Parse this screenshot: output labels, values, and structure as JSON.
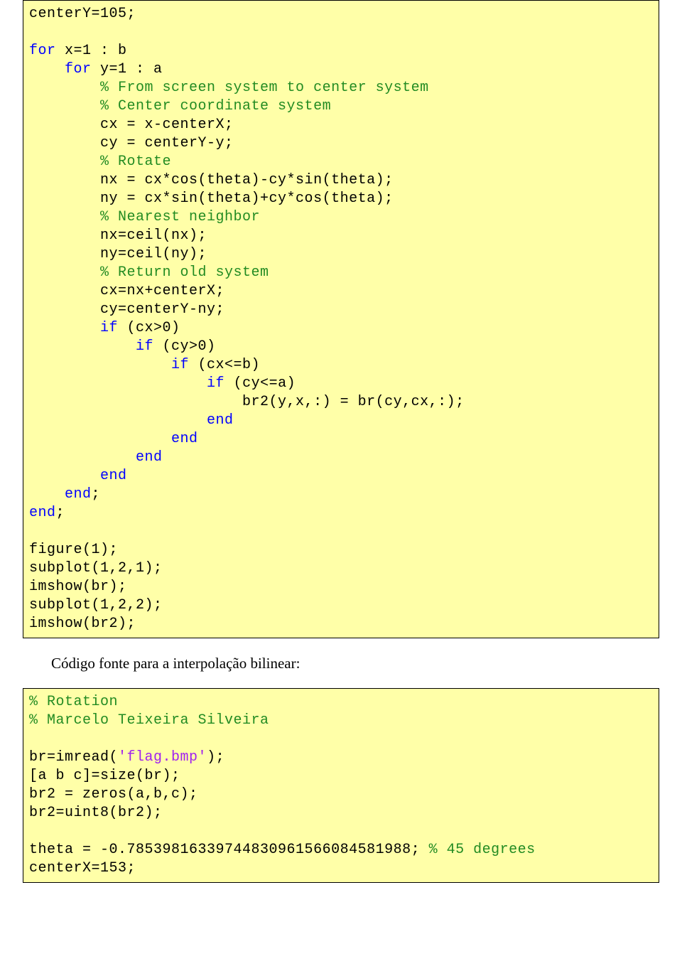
{
  "code1": {
    "l0": "centerY=105;",
    "l1": "",
    "k_for": "for",
    "x_loop": " x=1 : b",
    "y_loop": " y=1 : a",
    "c1": "% From screen system to center system",
    "c2": "% Center coordinate system",
    "l2": "cx = x-centerX;",
    "l3": "cy = centerY-y;",
    "c3": "% Rotate",
    "l4": "nx = cx*cos(theta)-cy*sin(theta);",
    "l5": "ny = cx*sin(theta)+cy*cos(theta);",
    "c4": "% Nearest neighbor",
    "l6": "nx=ceil(nx);",
    "l7": "ny=ceil(ny);",
    "c5": "% Return old system",
    "l8": "cx=nx+centerX;",
    "l9": "cy=centerY-ny;",
    "k_if": "if",
    "if1": " (cx>0)",
    "if2": " (cy>0)",
    "if3": " (cx<=b)",
    "if4": " (cy<=a)",
    "l10": "br2(y,x,:) = br(cy,cx,:);",
    "k_end": "end",
    "l11": "end;",
    "l12": "figure(1);",
    "l13": "subplot(1,2,1);",
    "l14": "imshow(br);",
    "l15": "subplot(1,2,2);",
    "l16": "imshow(br2);"
  },
  "paragraph": "Código fonte para a interpolação bilinear:",
  "code2": {
    "c1": "% Rotation",
    "c2": "% Marcelo Teixeira Silveira",
    "l1_a": "br=imread(",
    "l1_str": "'flag.bmp'",
    "l1_b": ");",
    "l2": "[a b c]=size(br);",
    "l3": "br2 = zeros(a,b,c);",
    "l4": "br2=uint8(br2);",
    "l5": "theta = -0.78539816339744830961566084581988; ",
    "c3": "% 45 degrees",
    "l6": "centerX=153;"
  }
}
